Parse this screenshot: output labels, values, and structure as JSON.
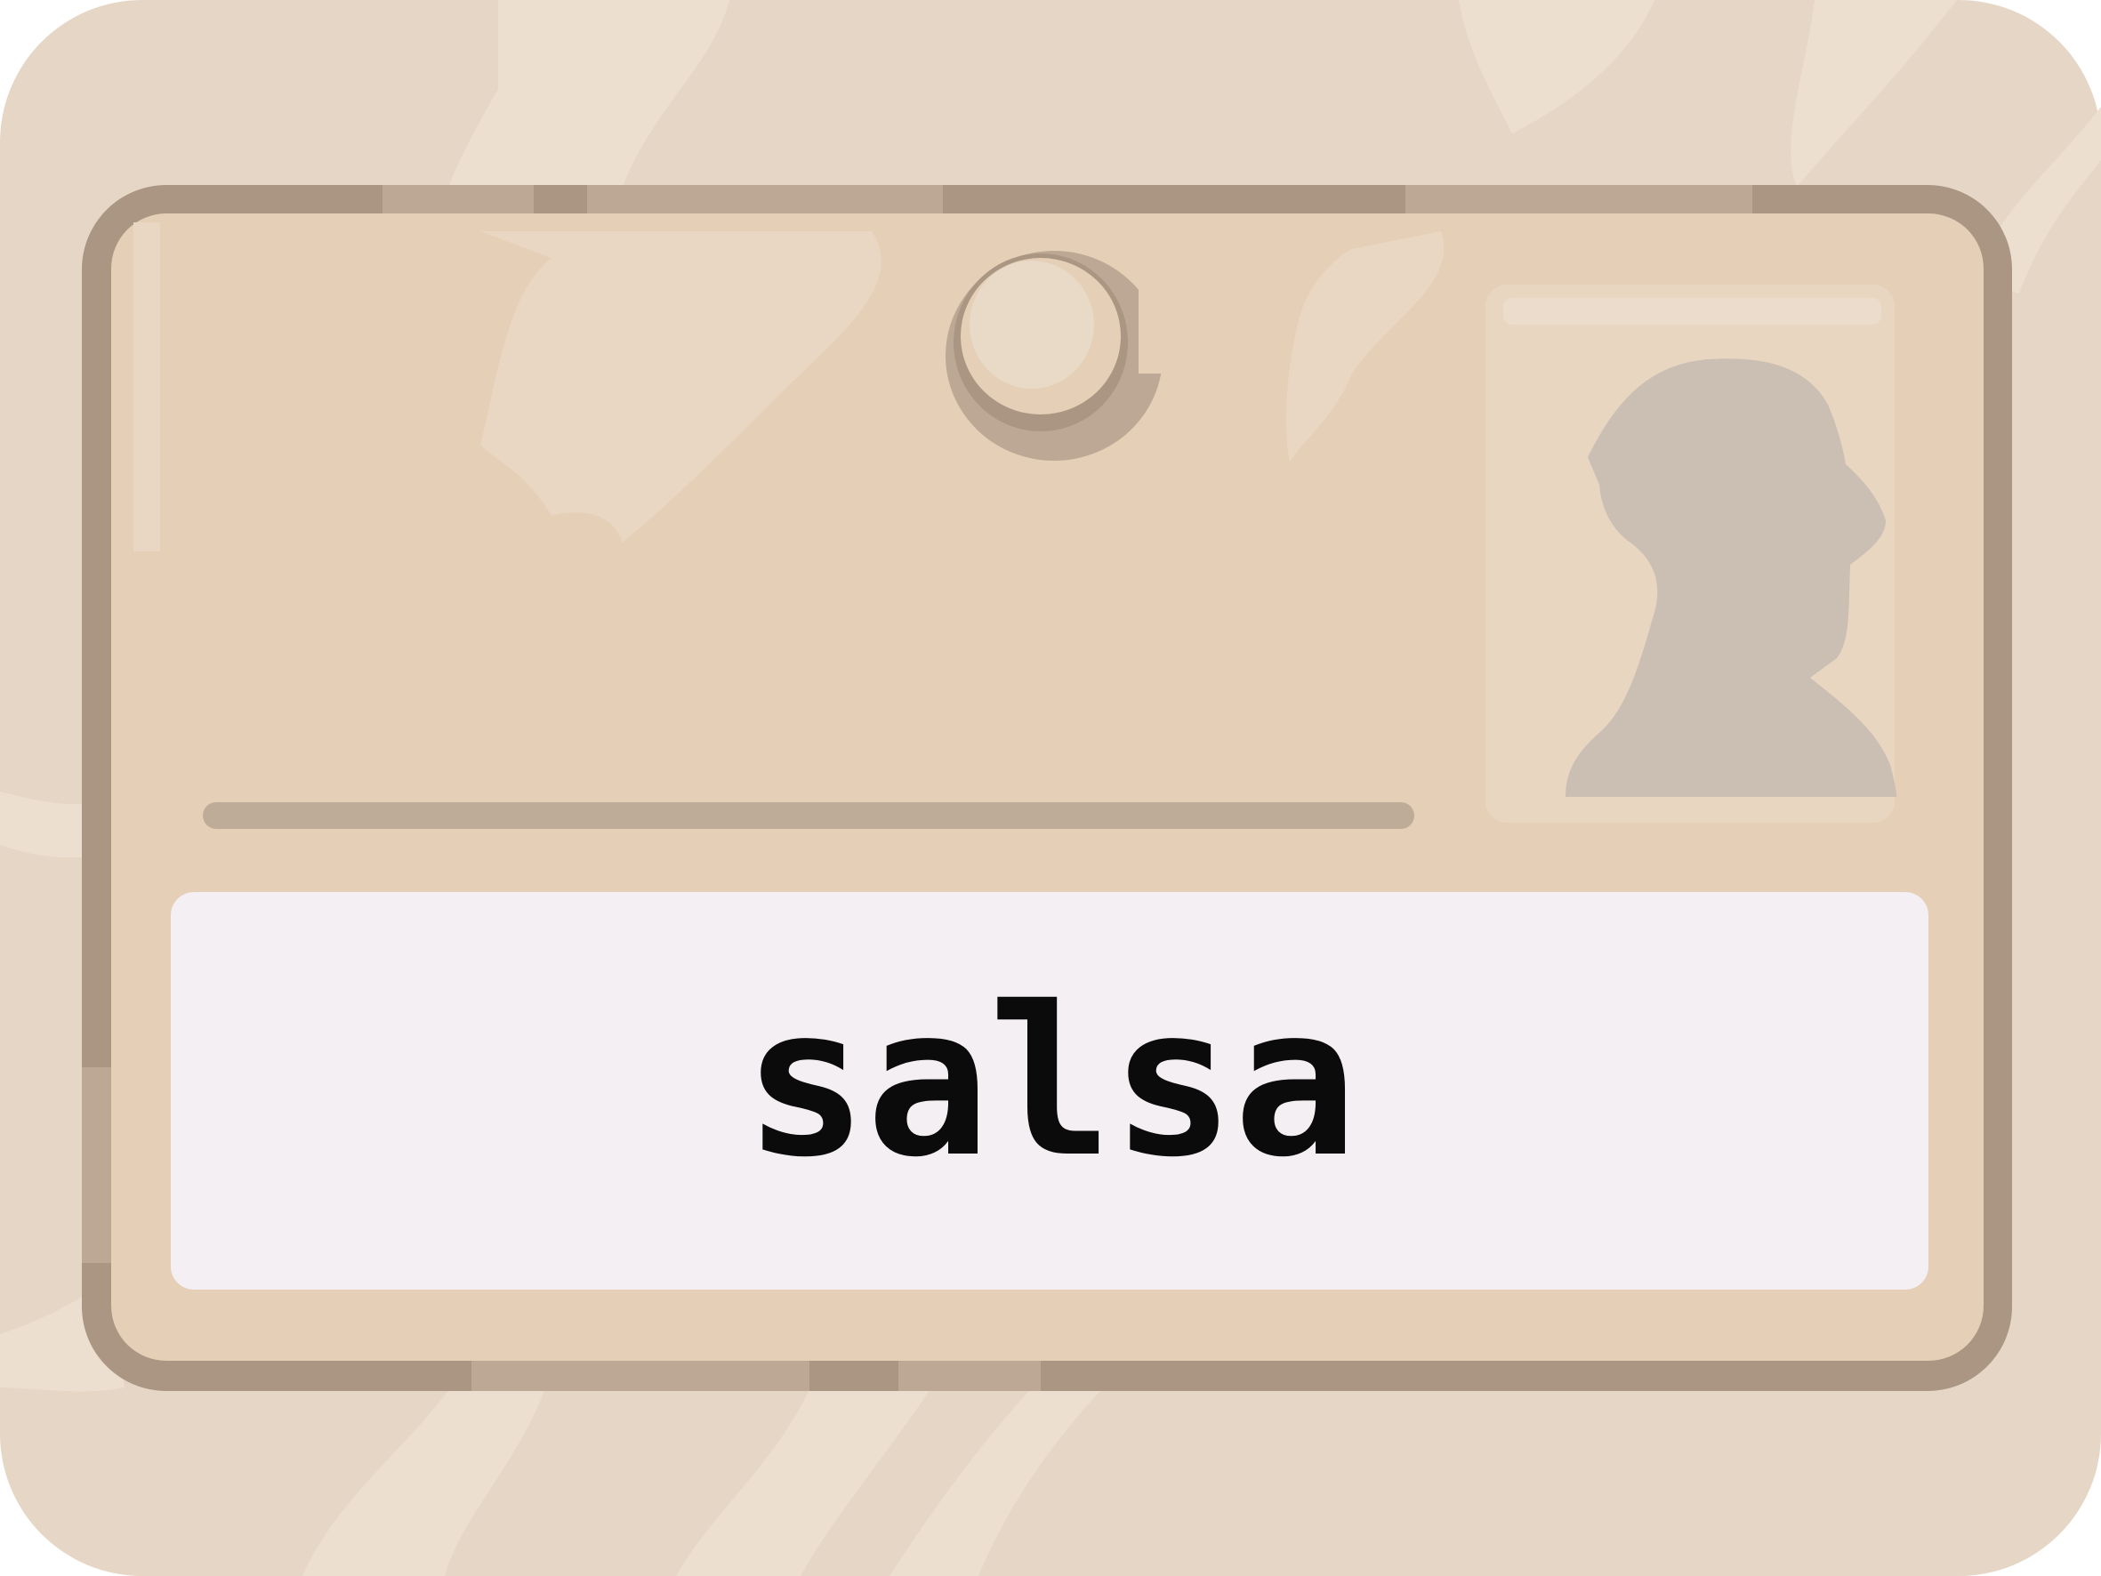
{
  "card": {
    "word": "salsa"
  },
  "colors": {
    "background": "#e6d6c5",
    "background_light": "#ecdfcf",
    "card_fill": "#e5cfb7",
    "card_border": "#aa9683",
    "card_border_light": "#bca894",
    "photo_frame": "#e8d6c1",
    "silhouette": "#cbbeb3",
    "name_line": "#bfac98",
    "label_fill": "#f4eff2",
    "text": "#0b0b0b"
  },
  "icons": {
    "photo": "person-silhouette-icon",
    "hole": "lanyard-hole-icon"
  }
}
